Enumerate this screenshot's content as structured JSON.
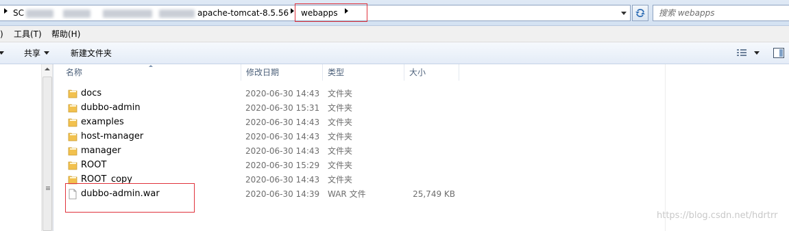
{
  "address_bar": {
    "crumbs": [
      {
        "label": "SC",
        "obscured": false
      },
      {
        "label": "",
        "obscured": true
      },
      {
        "label": "apache-tomcat-8.5.56",
        "obscured": false
      },
      {
        "label": "webapps",
        "obscured": false
      }
    ],
    "search_placeholder": "搜索 webapps"
  },
  "menu": {
    "items": [
      {
        "label": ")"
      },
      {
        "label": "工具(T)"
      },
      {
        "label": "帮助(H)"
      }
    ]
  },
  "toolbar": {
    "share_label": "共享",
    "new_folder_label": "新建文件夹"
  },
  "columns": {
    "name": "名称",
    "date": "修改日期",
    "type": "类型",
    "size": "大小"
  },
  "files": [
    {
      "name": "docs",
      "date": "2020-06-30 14:43",
      "type": "文件夹",
      "size": "",
      "kind": "folder"
    },
    {
      "name": "dubbo-admin",
      "date": "2020-06-30 15:31",
      "type": "文件夹",
      "size": "",
      "kind": "folder"
    },
    {
      "name": "examples",
      "date": "2020-06-30 14:43",
      "type": "文件夹",
      "size": "",
      "kind": "folder"
    },
    {
      "name": "host-manager",
      "date": "2020-06-30 14:43",
      "type": "文件夹",
      "size": "",
      "kind": "folder"
    },
    {
      "name": "manager",
      "date": "2020-06-30 14:43",
      "type": "文件夹",
      "size": "",
      "kind": "folder"
    },
    {
      "name": "ROOT",
      "date": "2020-06-30 15:29",
      "type": "文件夹",
      "size": "",
      "kind": "folder"
    },
    {
      "name": "ROOT_copy",
      "date": "2020-06-30 14:43",
      "type": "文件夹",
      "size": "",
      "kind": "folder"
    },
    {
      "name": "dubbo-admin.war",
      "date": "2020-06-30 14:39",
      "type": "WAR 文件",
      "size": "25,749 KB",
      "kind": "file"
    }
  ],
  "watermark": "https://blog.csdn.net/hdrtrr",
  "colors": {
    "annotation_red": "#e0303a",
    "header_text": "#4c607a",
    "secondary_text": "#6d6d6d",
    "folder_yellow": "#f2c14e"
  }
}
